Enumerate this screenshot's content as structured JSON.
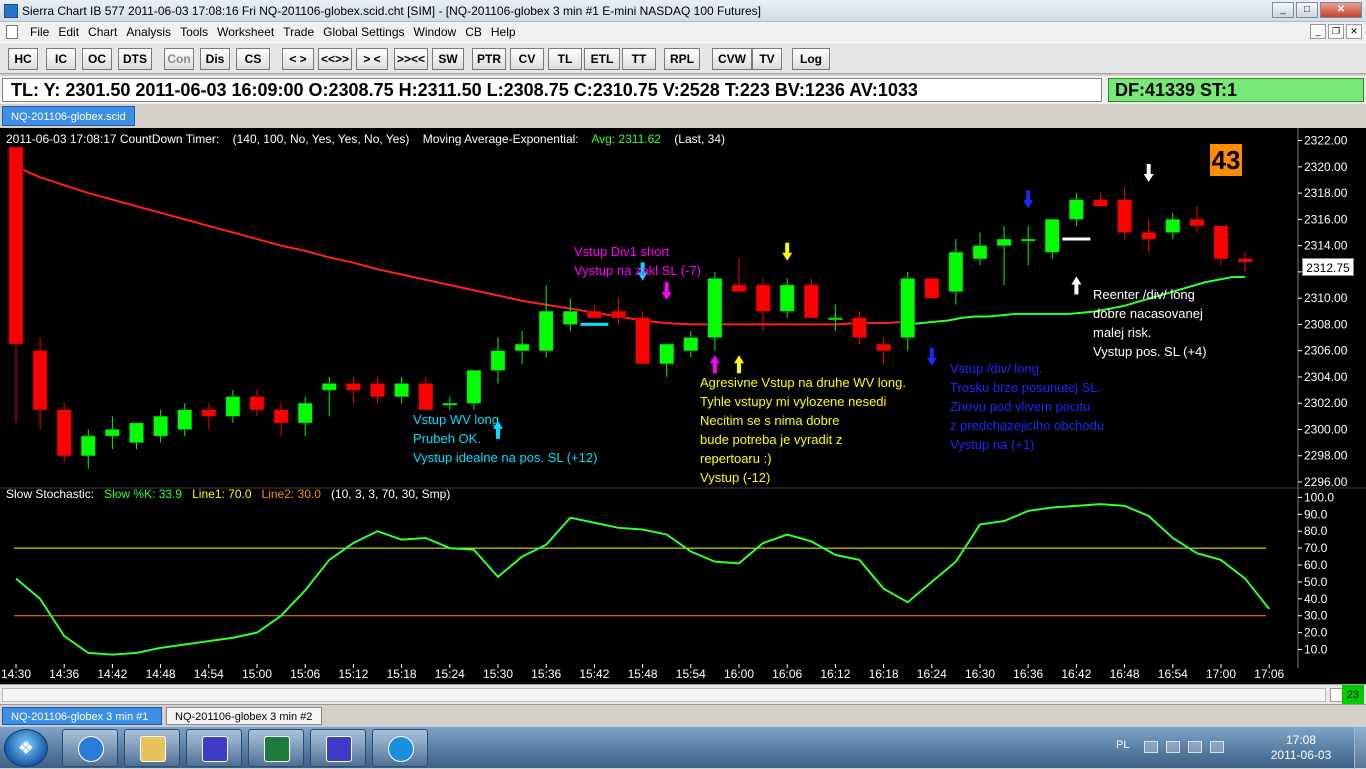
{
  "window": {
    "title": "Sierra Chart IB 577   2011-06-03   17:08:16   Fri    NQ-201106-globex.scid.cht [SIM]  -  [NQ-201106-globex  3 min   #1  E-mini NASDAQ 100 Futures]",
    "minimize": "_",
    "maximize": "□",
    "close": "✕"
  },
  "menu": [
    "File",
    "Edit",
    "Chart",
    "Analysis",
    "Tools",
    "Worksheet",
    "Trade",
    "Global Settings",
    "Window",
    "CB",
    "Help"
  ],
  "mdi_buttons": [
    "_",
    "❐",
    "✕"
  ],
  "toolbar": [
    {
      "label": "HC",
      "disabled": false
    },
    {
      "label": "IC",
      "disabled": false
    },
    {
      "label": "OC",
      "disabled": false
    },
    {
      "label": "DTS",
      "disabled": false
    },
    {
      "label": "Con",
      "disabled": true
    },
    {
      "label": "Dis",
      "disabled": false
    },
    {
      "label": "CS",
      "disabled": false
    },
    {
      "label": "< >",
      "disabled": false
    },
    {
      "label": "<<>>",
      "disabled": false
    },
    {
      "label": "> <",
      "disabled": false
    },
    {
      "label": ">><<",
      "disabled": false
    },
    {
      "label": "SW",
      "disabled": false
    },
    {
      "label": "PTR",
      "disabled": false
    },
    {
      "label": "CV",
      "disabled": false
    },
    {
      "label": "TL",
      "disabled": false
    },
    {
      "label": "ETL",
      "disabled": false
    },
    {
      "label": "TT",
      "disabled": false
    },
    {
      "label": "RPL",
      "disabled": false
    },
    {
      "label": "CVW",
      "disabled": false
    },
    {
      "label": "TV",
      "disabled": false
    },
    {
      "label": "Log",
      "disabled": false
    }
  ],
  "info": {
    "main": "TL: Y: 2301.50   2011-06-03   16:09:00   O:2308.75   H:2311.50   L:2308.75   C:2310.75   V:2528   T:223   BV:1236   AV:1033",
    "df": "DF:41339   ST:1"
  },
  "top_tab": "NQ-201106-globex.scid",
  "header": {
    "timer_text": "2011-06-03 17:08:17 CountDown Timer:",
    "timer_params": "(140, 100, No, Yes, Yes, No, Yes)",
    "ma_label": "Moving Average-Exponential:",
    "ma_value": "Avg: 2311.62",
    "ma_params": "(Last, 34)",
    "countdown": "43",
    "stoch_label": "Slow Stochastic:",
    "stoch_k": "Slow %K: 33.9",
    "stoch_line1": "Line1: 70.0",
    "stoch_line2": "Line2: 30.0",
    "stoch_params": "(10, 3, 3, 70, 30, Smp)",
    "last_price": "2312.75"
  },
  "colors": {
    "bull": "#00ff00",
    "bear": "#ff0000",
    "ma": "#ff2020",
    "ma2": "#33ff33",
    "stoch": "#33ff33",
    "line1": "#ffff00",
    "line2": "#ff8c00",
    "cyan": "#00e0ff",
    "magenta": "#ff00ff",
    "yellow": "#ffff00",
    "blue": "#1c28ff",
    "white": "#ffffff"
  },
  "annotations": [
    {
      "color": "magenta",
      "lines": [
        "Vstup Div1 short",
        "Vystup na zakl SL (-7)"
      ]
    },
    {
      "color": "cyan",
      "lines": [
        "Vstup WV long",
        "Prubeh OK.",
        "Vystup idealne na pos. SL (+12)"
      ]
    },
    {
      "color": "yellow",
      "lines": [
        "Agresivne Vstup na druhe WV long.",
        "Tyhle vstupy mi vylozene nesedi",
        "Necitim se s nima dobre",
        "bude potreba je vyradit z",
        "repertoaru :)",
        "Vystup (-12)"
      ]
    },
    {
      "color": "blue",
      "lines": [
        "Vstup /div/ long.",
        "Trosku brzo posunutej SL.",
        "Znovu pod vlivem pocitu",
        "z predchazejiciho obchodu",
        "Vystup na (+1)"
      ]
    },
    {
      "color": "white",
      "lines": [
        "Reenter /div/ long",
        "dobre nacasovanej",
        "malej risk.",
        "Vystup pos. SL (+4)"
      ]
    }
  ],
  "chart_data": [
    {
      "type": "candlestick",
      "title": "NQ-201106-globex  3 min",
      "ylim": [
        2296,
        2322.5
      ],
      "y_ticks": [
        "2322.00",
        "2320.00",
        "2318.00",
        "2316.00",
        "2314.00",
        "2312.00",
        "2310.00",
        "2308.00",
        "2306.00",
        "2304.00",
        "2302.00",
        "2300.00",
        "2298.00",
        "2296.00"
      ],
      "x_ticks": [
        "14:30",
        "14:36",
        "14:42",
        "14:48",
        "14:54",
        "15:00",
        "15:06",
        "15:12",
        "15:18",
        "15:24",
        "15:30",
        "15:36",
        "15:42",
        "15:48",
        "15:54",
        "16:00",
        "16:06",
        "16:12",
        "16:18",
        "16:24",
        "16:30",
        "16:36",
        "16:42",
        "16:48",
        "16:54",
        "17:00",
        "17:06"
      ],
      "candles": [
        {
          "o": 2321.5,
          "h": 2321.5,
          "l": 2300.5,
          "c": 2306.5
        },
        {
          "o": 2306.0,
          "h": 2307.0,
          "l": 2300.0,
          "c": 2301.5
        },
        {
          "o": 2301.5,
          "h": 2302.0,
          "l": 2297.5,
          "c": 2298.0
        },
        {
          "o": 2298.0,
          "h": 2300.0,
          "l": 2297.0,
          "c": 2299.5
        },
        {
          "o": 2299.5,
          "h": 2301.0,
          "l": 2298.5,
          "c": 2300.0
        },
        {
          "o": 2299.0,
          "h": 2300.5,
          "l": 2298.5,
          "c": 2300.5
        },
        {
          "o": 2299.5,
          "h": 2301.5,
          "l": 2299.0,
          "c": 2301.0
        },
        {
          "o": 2300.0,
          "h": 2302.0,
          "l": 2299.5,
          "c": 2301.5
        },
        {
          "o": 2301.5,
          "h": 2302.0,
          "l": 2300.0,
          "c": 2301.0
        },
        {
          "o": 2301.0,
          "h": 2303.0,
          "l": 2300.5,
          "c": 2302.5
        },
        {
          "o": 2302.5,
          "h": 2303.0,
          "l": 2301.0,
          "c": 2301.5
        },
        {
          "o": 2301.5,
          "h": 2302.0,
          "l": 2299.5,
          "c": 2300.5
        },
        {
          "o": 2300.5,
          "h": 2302.5,
          "l": 2299.5,
          "c": 2302.0
        },
        {
          "o": 2303.0,
          "h": 2304.0,
          "l": 2301.0,
          "c": 2303.5
        },
        {
          "o": 2303.5,
          "h": 2304.0,
          "l": 2302.0,
          "c": 2303.0
        },
        {
          "o": 2303.5,
          "h": 2304.0,
          "l": 2302.0,
          "c": 2302.5
        },
        {
          "o": 2302.5,
          "h": 2304.0,
          "l": 2302.0,
          "c": 2303.5
        },
        {
          "o": 2303.5,
          "h": 2304.0,
          "l": 2301.5,
          "c": 2301.5
        },
        {
          "o": 2302.0,
          "h": 2302.5,
          "l": 2301.5,
          "c": 2302.0
        },
        {
          "o": 2302.0,
          "h": 2304.5,
          "l": 2301.5,
          "c": 2304.5
        },
        {
          "o": 2304.5,
          "h": 2307.0,
          "l": 2303.5,
          "c": 2306.0
        },
        {
          "o": 2306.0,
          "h": 2307.5,
          "l": 2305.0,
          "c": 2306.5
        },
        {
          "o": 2306.0,
          "h": 2311.0,
          "l": 2305.5,
          "c": 2309.0
        },
        {
          "o": 2308.0,
          "h": 2310.0,
          "l": 2307.5,
          "c": 2309.0
        },
        {
          "o": 2309.0,
          "h": 2309.5,
          "l": 2308.5,
          "c": 2308.5
        },
        {
          "o": 2309.0,
          "h": 2310.0,
          "l": 2308.0,
          "c": 2308.5
        },
        {
          "o": 2308.5,
          "h": 2309.0,
          "l": 2305.0,
          "c": 2305.0
        },
        {
          "o": 2305.0,
          "h": 2306.5,
          "l": 2304.0,
          "c": 2306.5
        },
        {
          "o": 2306.0,
          "h": 2307.5,
          "l": 2305.5,
          "c": 2307.0
        },
        {
          "o": 2307.0,
          "h": 2312.0,
          "l": 2306.0,
          "c": 2311.5
        },
        {
          "o": 2311.0,
          "h": 2313.0,
          "l": 2310.5,
          "c": 2310.5
        },
        {
          "o": 2311.0,
          "h": 2311.5,
          "l": 2307.5,
          "c": 2309.0
        },
        {
          "o": 2309.0,
          "h": 2311.5,
          "l": 2308.5,
          "c": 2311.0
        },
        {
          "o": 2311.0,
          "h": 2311.5,
          "l": 2308.5,
          "c": 2308.5
        },
        {
          "o": 2308.5,
          "h": 2309.5,
          "l": 2307.5,
          "c": 2308.5
        },
        {
          "o": 2308.5,
          "h": 2309.0,
          "l": 2306.5,
          "c": 2307.0
        },
        {
          "o": 2306.5,
          "h": 2307.0,
          "l": 2305.0,
          "c": 2306.0
        },
        {
          "o": 2307.0,
          "h": 2312.0,
          "l": 2306.0,
          "c": 2311.5
        },
        {
          "o": 2311.5,
          "h": 2311.5,
          "l": 2310.0,
          "c": 2310.0
        },
        {
          "o": 2310.5,
          "h": 2314.5,
          "l": 2309.5,
          "c": 2313.5
        },
        {
          "o": 2313.0,
          "h": 2315.0,
          "l": 2312.5,
          "c": 2314.0
        },
        {
          "o": 2314.0,
          "h": 2315.5,
          "l": 2311.0,
          "c": 2314.5
        },
        {
          "o": 2314.5,
          "h": 2315.5,
          "l": 2312.5,
          "c": 2314.5
        },
        {
          "o": 2313.5,
          "h": 2316.0,
          "l": 2313.0,
          "c": 2316.0
        },
        {
          "o": 2316.0,
          "h": 2318.0,
          "l": 2315.5,
          "c": 2317.5
        },
        {
          "o": 2317.5,
          "h": 2318.0,
          "l": 2317.0,
          "c": 2317.0
        },
        {
          "o": 2317.5,
          "h": 2318.5,
          "l": 2314.5,
          "c": 2315.0
        },
        {
          "o": 2315.0,
          "h": 2316.0,
          "l": 2313.5,
          "c": 2314.5
        },
        {
          "o": 2315.0,
          "h": 2316.5,
          "l": 2314.5,
          "c": 2316.0
        },
        {
          "o": 2316.0,
          "h": 2317.0,
          "l": 2315.0,
          "c": 2315.5
        },
        {
          "o": 2315.5,
          "h": 2315.5,
          "l": 2312.5,
          "c": 2313.0
        },
        {
          "o": 2313.0,
          "h": 2313.5,
          "l": 2312.0,
          "c": 2312.75
        }
      ],
      "ema": [
        2320.0,
        2319.2,
        2318.6,
        2318.0,
        2317.5,
        2317.0,
        2316.5,
        2316.0,
        2315.5,
        2315.0,
        2314.5,
        2314.0,
        2313.6,
        2313.1,
        2312.7,
        2312.2,
        2311.8,
        2311.4,
        2311.0,
        2310.6,
        2310.2,
        2309.8,
        2309.5,
        2309.2,
        2308.9,
        2308.6,
        2308.3,
        2308.1,
        2308.0,
        2308.0,
        2308.0,
        2308.0,
        2308.0,
        2308.0,
        2308.0,
        2308.1,
        2308.1,
        2308.2
      ],
      "ema2": [
        2308.0,
        2308.1,
        2308.2,
        2308.3,
        2308.5,
        2308.6,
        2308.6,
        2308.7,
        2308.8,
        2308.8,
        2308.8,
        2308.8,
        2308.8,
        2308.9,
        2309.0,
        2309.2,
        2309.4,
        2309.7,
        2310.0,
        2310.3,
        2310.6,
        2310.9,
        2311.2,
        2311.4,
        2311.6,
        2311.62
      ],
      "trade_markers": [
        {
          "type": "down-arrow",
          "color": "cyan",
          "index": 26,
          "price": 2311.5
        },
        {
          "type": "down-arrow",
          "color": "magenta",
          "index": 27,
          "price": 2310.0
        },
        {
          "type": "up-arrow",
          "color": "cyan",
          "index": 20,
          "price": 2300.5
        },
        {
          "type": "dash",
          "color": "cyan",
          "index": 24,
          "price": 2308.0
        },
        {
          "type": "up-arrow",
          "color": "magenta",
          "index": 29,
          "price": 2305.5
        },
        {
          "type": "up-arrow",
          "color": "yellow",
          "index": 30,
          "price": 2305.5
        },
        {
          "type": "down-arrow",
          "color": "yellow",
          "index": 32,
          "price": 2313.0
        },
        {
          "type": "down-arrow",
          "color": "blue",
          "index": 38,
          "price": 2305.0
        },
        {
          "type": "down-arrow",
          "color": "blue",
          "index": 42,
          "price": 2317.0
        },
        {
          "type": "up-arrow",
          "color": "white",
          "index": 44,
          "price": 2311.5
        },
        {
          "type": "dash",
          "color": "white",
          "index": 44,
          "price": 2314.5
        },
        {
          "type": "down-arrow",
          "color": "white",
          "index": 47,
          "price": 2319.0
        }
      ]
    },
    {
      "type": "line",
      "title": "Slow Stochastic",
      "ylim": [
        5,
        102
      ],
      "y_ticks": [
        "100.0",
        "90.0",
        "80.0",
        "70.0",
        "60.0",
        "50.0",
        "40.0",
        "30.0",
        "20.0",
        "10.0"
      ],
      "line1": 70.0,
      "line2": 30.0,
      "series": [
        {
          "name": "Slow %K",
          "values": [
            52,
            40,
            18,
            8,
            7,
            8,
            11,
            13,
            15,
            17,
            20,
            30,
            45,
            63,
            73,
            80,
            75,
            76,
            70,
            69,
            53,
            65,
            72,
            88,
            85,
            82,
            81,
            78,
            68,
            62,
            61,
            73,
            78,
            74,
            66,
            63,
            46,
            38,
            50,
            62,
            84,
            86,
            92,
            94,
            95,
            96,
            95,
            89,
            76,
            67,
            63,
            52,
            34
          ]
        }
      ]
    }
  ],
  "scrollbar": {
    "bar_count": "23"
  },
  "bottom_tabs": [
    {
      "label": "NQ-201106-globex  3 min   #1",
      "active": true
    },
    {
      "label": "NQ-201106-globex  3 min   #2",
      "active": false
    }
  ],
  "taskbar": {
    "apps": [
      "ie-globe-icon",
      "explorer-folder-icon",
      "sierra-chart-icon",
      "excel-icon",
      "sierra-chart-2-icon",
      "internet-explorer-icon"
    ],
    "lang": "PL",
    "time": "17:08",
    "date": "2011-06-03"
  }
}
